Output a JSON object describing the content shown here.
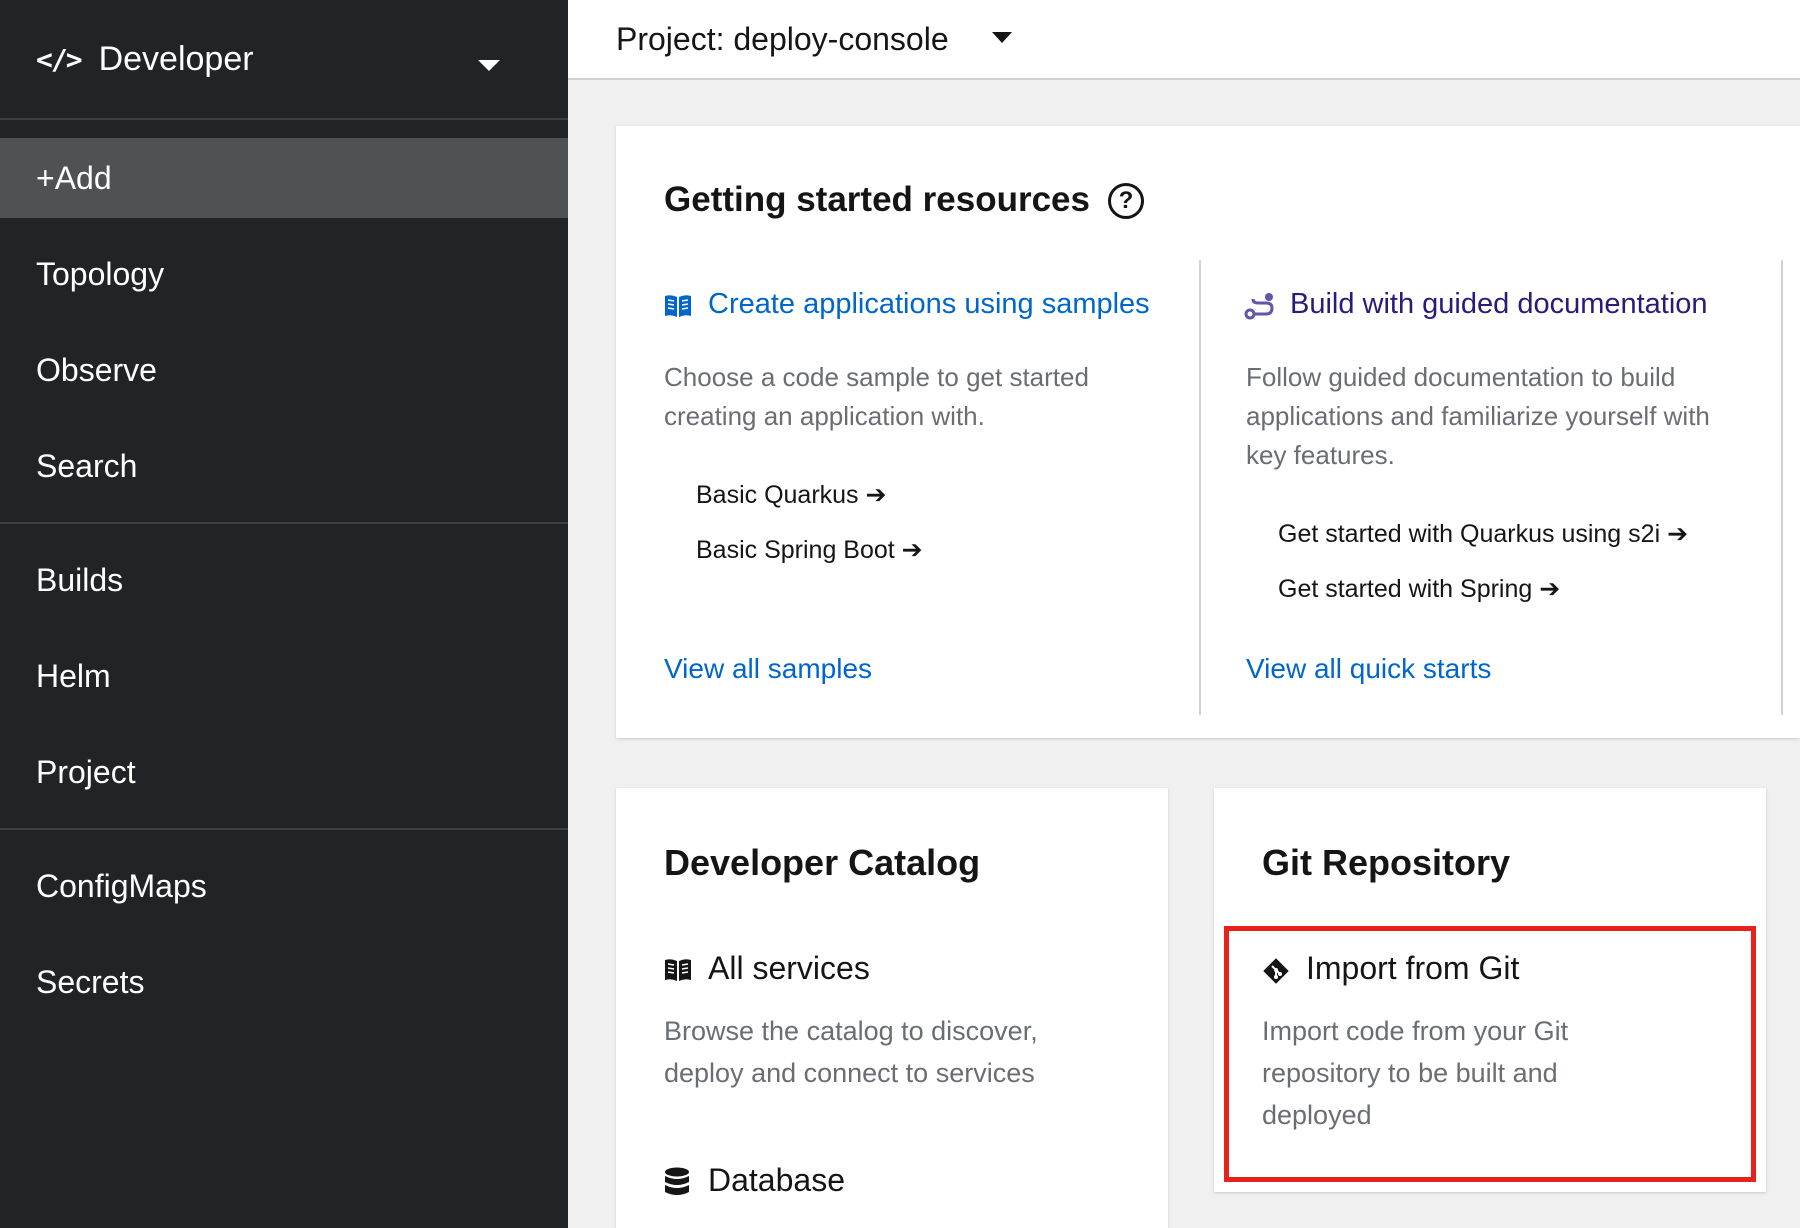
{
  "sidebar": {
    "perspective": {
      "icon": "code-icon",
      "label": "Developer"
    },
    "items": [
      {
        "label": "+Add",
        "active": true
      },
      {
        "label": "Topology"
      },
      {
        "label": "Observe"
      },
      {
        "label": "Search"
      },
      {
        "label": "Builds"
      },
      {
        "label": "Helm"
      },
      {
        "label": "Project"
      },
      {
        "label": "ConfigMaps"
      },
      {
        "label": "Secrets"
      }
    ]
  },
  "topbar": {
    "project_label": "Project: deploy-console"
  },
  "getting_started": {
    "title": "Getting started resources",
    "samples": {
      "icon": "book-open-icon",
      "heading": "Create applications using samples",
      "description_line1": "Choose a code sample to get started",
      "description_line2": "creating an application with.",
      "links": [
        "Basic Quarkus",
        "Basic Spring Boot"
      ],
      "view_all": "View all samples"
    },
    "guided": {
      "icon": "route-icon",
      "heading": "Build with guided documentation",
      "description_line1": "Follow guided documentation to build",
      "description_line2": "applications and familiarize yourself with",
      "description_line3": "key features.",
      "links": [
        "Get started with Quarkus using s2i",
        "Get started with Spring"
      ],
      "view_all": "View all quick starts"
    }
  },
  "developer_catalog": {
    "title": "Developer Catalog",
    "all_services": {
      "icon": "book-open-icon",
      "title": "All services",
      "description_line1": "Browse the catalog to discover,",
      "description_line2": "deploy and connect to services"
    },
    "database": {
      "icon": "database-icon",
      "title": "Database"
    }
  },
  "git_repository": {
    "title": "Git Repository",
    "import": {
      "icon": "git-icon",
      "title": "Import from Git",
      "description_line1": "Import code from your Git",
      "description_line2": "repository to be built and",
      "description_line3": "deployed"
    }
  },
  "colors": {
    "sidebar_bg": "#212427",
    "active_item_bg": "#4f5255",
    "link_blue": "#0066cc",
    "guided_purple": "#2b1a7a",
    "highlight_red": "#e8211a"
  }
}
